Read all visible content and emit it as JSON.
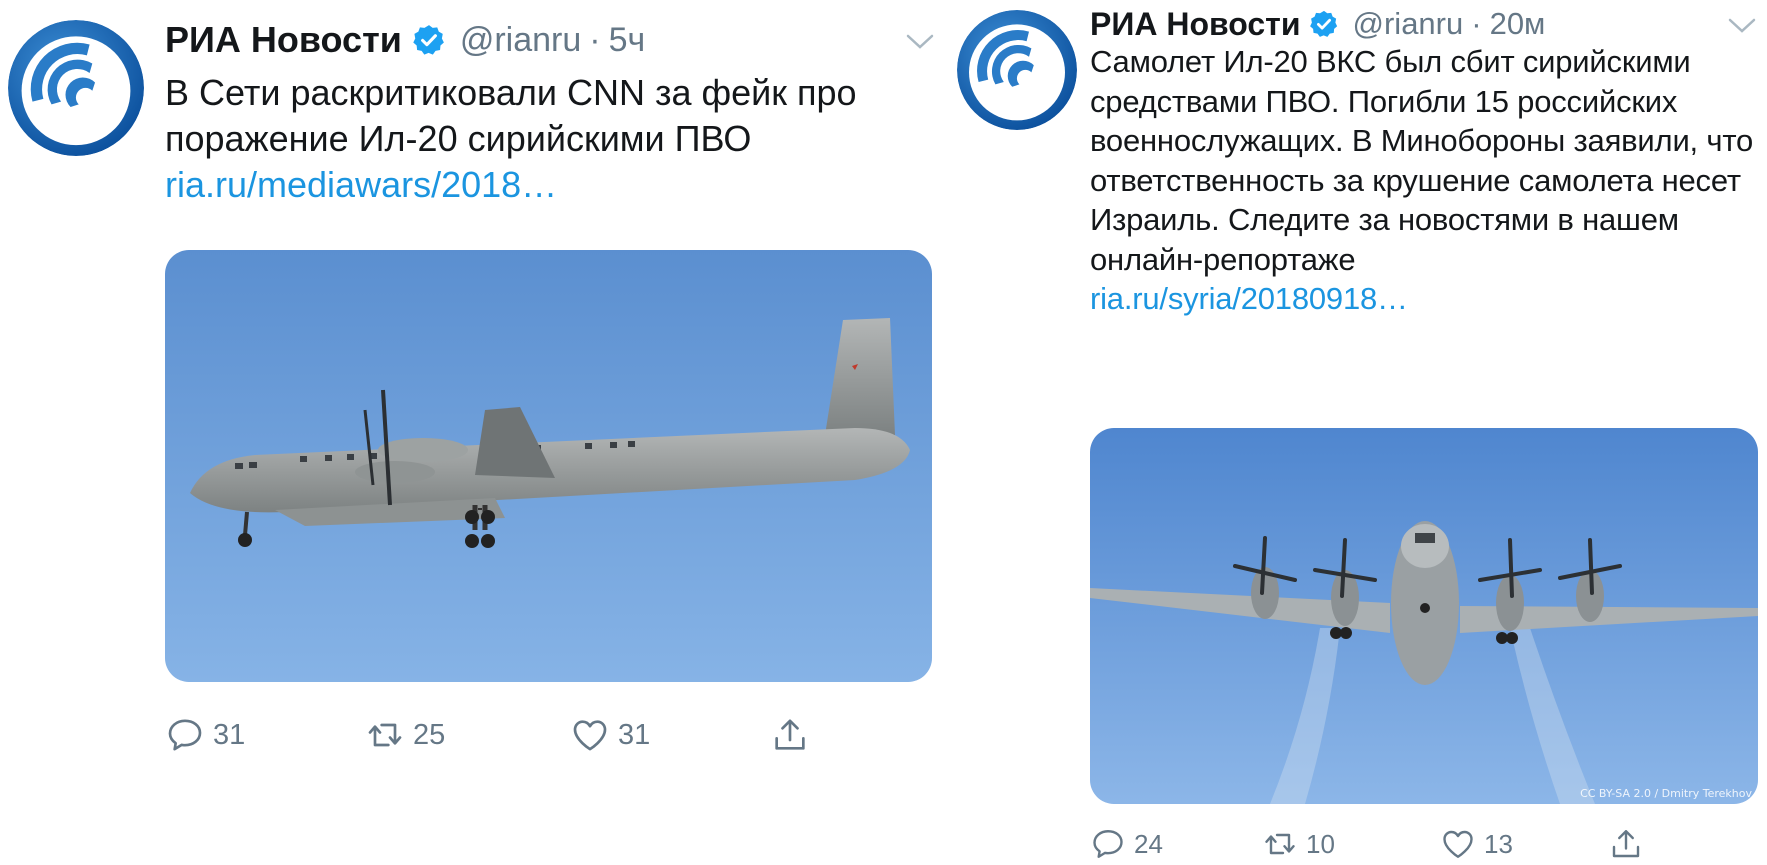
{
  "colors": {
    "link": "#1b95e0",
    "verified": "#1da1f2",
    "muted": "#657786",
    "sky_top": "#5b8fd0",
    "sky_bottom": "#8cb6e8"
  },
  "tweets": [
    {
      "name": "РИА Новости",
      "handle": "@rianru",
      "dot": "·",
      "time": "5ч",
      "text": "В Сети раскритиковали CNN за фейк про поражение Ил-20 сирийскими ПВО",
      "link": "ria.ru/mediawars/2018…",
      "actions": {
        "replies": "31",
        "retweets": "25",
        "likes": "31"
      },
      "icons": [
        "avatar",
        "verified-icon",
        "chevron-down-icon",
        "reply-icon",
        "retweet-icon",
        "like-icon",
        "share-icon"
      ]
    },
    {
      "name": "РИА Новости",
      "handle": "@rianru",
      "dot": "·",
      "time": "20м",
      "text": "Самолет Ил-20 ВКС был сбит сирийскими средствами ПВО. Погибли 15 российских военнослужащих. В Минобороны заявили, что ответственность за крушение самолета несет Израиль. Следите за новостями в нашем онлайн-репортаже",
      "link": "ria.ru/syria/20180918…",
      "media_credit": "CC BY-SA 2.0 / Dmitry Terekhov",
      "actions": {
        "replies": "24",
        "retweets": "10",
        "likes": "13"
      },
      "icons": [
        "avatar",
        "verified-icon",
        "chevron-down-icon",
        "reply-icon",
        "retweet-icon",
        "like-icon",
        "share-icon"
      ]
    }
  ]
}
